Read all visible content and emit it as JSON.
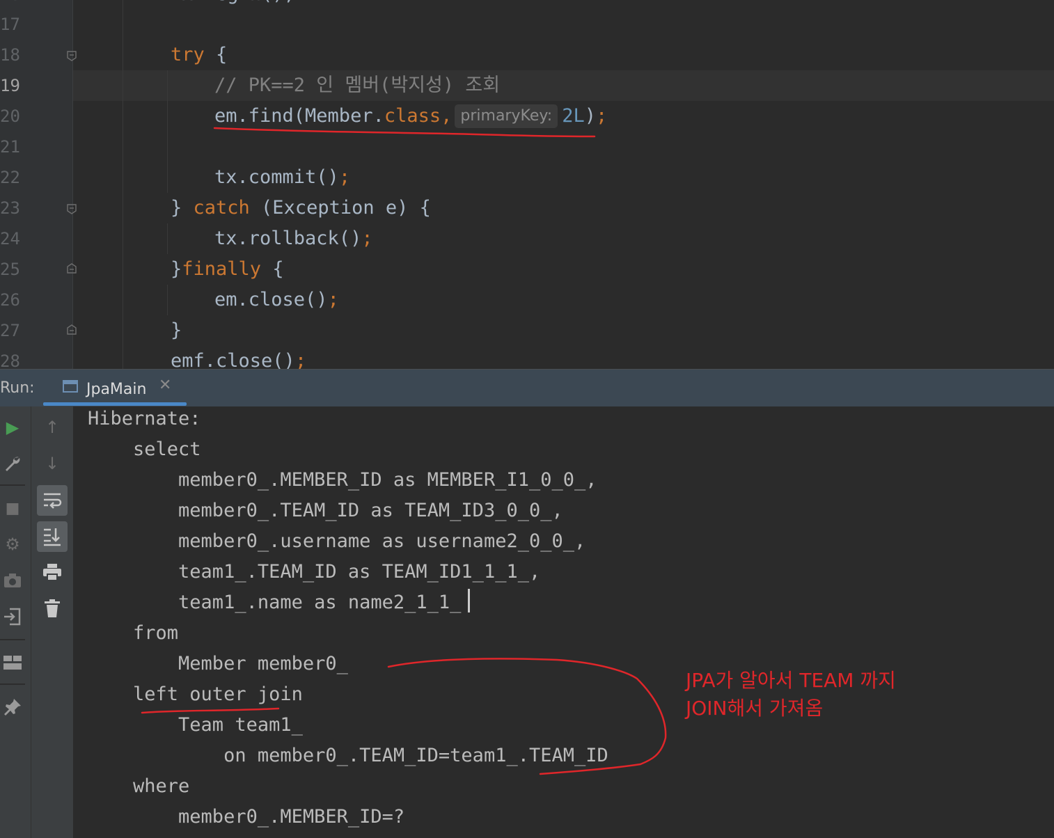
{
  "editor": {
    "line_numbers": [
      "17",
      "18",
      "19",
      "20",
      "21",
      "22",
      "23",
      "24",
      "25",
      "26",
      "27",
      "28"
    ],
    "current_line": "19",
    "lines": {
      "l17": "",
      "l18_kw": "try",
      "l18_rest": " {",
      "l19_comment": "// PK==2 인 멤버(박지성) 조회",
      "l20_pre": "em.find(Member.",
      "l20_kw": "class,",
      "l20_hint": "primaryKey:",
      "l20_num": "2L",
      "l20_post": ")",
      "l20_semi": ";",
      "l22_code": "tx.commit()",
      "l22_semi": ";",
      "l23_pre": "} ",
      "l23_kw": "catch",
      "l23_rest": " (Exception e) {",
      "l24_code": "tx.rollback()",
      "l24_semi": ";",
      "l25_pre": "}",
      "l25_kw": "finally",
      "l25_rest": " {",
      "l26_code": "em.close()",
      "l26_semi": ";",
      "l27_code": "}",
      "l28_code": "emf.close()",
      "l28_semi": ";"
    }
  },
  "run_panel": {
    "label": "Run:",
    "tab_title": "JpaMain",
    "close_glyph": "✕"
  },
  "toolbar": {
    "rerun_glyph": "▶",
    "settings_glyph": "🔧",
    "stop_glyph": "■",
    "debug_glyph": "⚙",
    "camera_glyph": "📷",
    "login_glyph": "⇥",
    "layout_glyph": "▦",
    "pin_glyph": "📌",
    "up_glyph": "↑",
    "down_glyph": "↓",
    "softwrap_glyph": "↩",
    "scroll_end_glyph": "⇊",
    "print_glyph": "⎙",
    "trash_glyph": "🗑"
  },
  "console": {
    "lines": [
      "Hibernate:",
      "    select",
      "        member0_.MEMBER_ID as MEMBER_I1_0_0_,",
      "        member0_.TEAM_ID as TEAM_ID3_0_0_,",
      "        member0_.username as username2_0_0_,",
      "        team1_.TEAM_ID as TEAM_ID1_1_1_,",
      "        team1_.name as name2_1_1_",
      "    from",
      "        Member member0_",
      "    left outer join",
      "        Team team1_",
      "            on member0_.TEAM_ID=team1_.TEAM_ID",
      "    where",
      "        member0_.MEMBER_ID=?"
    ]
  },
  "annotation": {
    "line1": "JPA가 알아서 TEAM 까지",
    "line2": "JOIN해서 가져옴",
    "color": "#e0262a"
  },
  "colors": {
    "keyword": "#cc7832",
    "comment": "#808080",
    "number": "#6897bb",
    "text": "#a9b7c6",
    "accent": "#4a88c7",
    "run_green": "#499c54"
  }
}
